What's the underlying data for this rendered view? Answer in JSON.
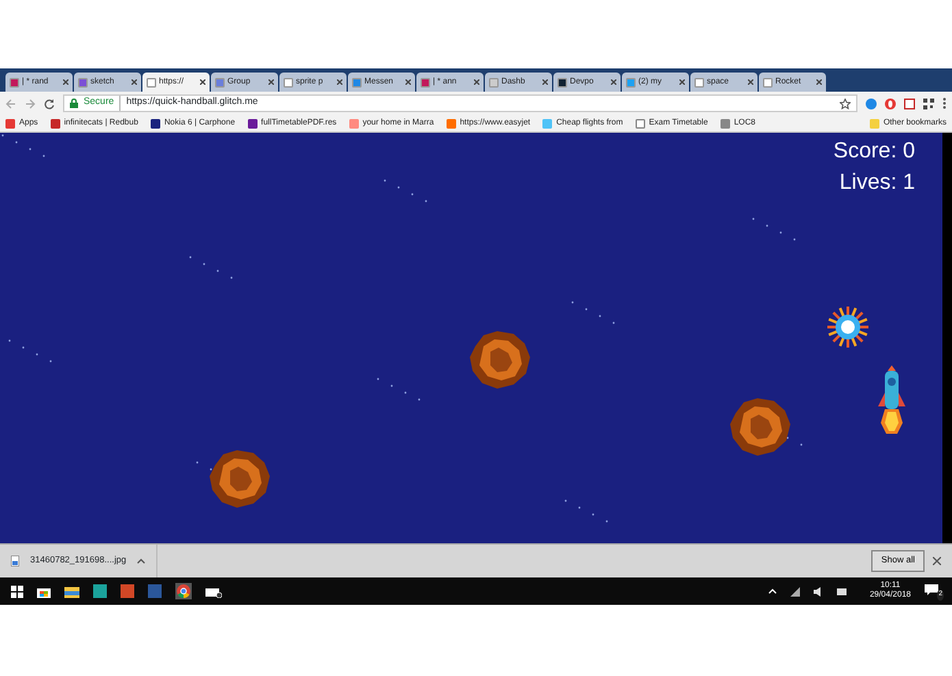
{
  "tabs": [
    {
      "label": "| * rand",
      "selected": false
    },
    {
      "label": "sketch",
      "selected": false
    },
    {
      "label": "https://",
      "selected": true
    },
    {
      "label": "Group",
      "selected": false
    },
    {
      "label": "sprite p",
      "selected": false
    },
    {
      "label": "Messen",
      "selected": false
    },
    {
      "label": "| * ann",
      "selected": false
    },
    {
      "label": "Dashb",
      "selected": false
    },
    {
      "label": "Devpo",
      "selected": false
    },
    {
      "label": "(2) my",
      "selected": false
    },
    {
      "label": "space",
      "selected": false
    },
    {
      "label": "Rocket",
      "selected": false
    }
  ],
  "address_bar": {
    "security": "Secure",
    "url": "https://quick-handball.glitch.me"
  },
  "bookmarks": [
    {
      "label": "Apps"
    },
    {
      "label": "infinitecats | Redbub"
    },
    {
      "label": "Nokia 6 | Carphone"
    },
    {
      "label": "fullTimetablePDF.res"
    },
    {
      "label": "your home in Marra"
    },
    {
      "label": "https://www.easyjet"
    },
    {
      "label": "Cheap flights from"
    },
    {
      "label": "Exam Timetable"
    },
    {
      "label": "LOC8"
    }
  ],
  "other_bookmarks": "Other bookmarks",
  "game": {
    "score": "Score: 0",
    "lives": "Lives: 1"
  },
  "download_bar": {
    "file": "31460782_191698....jpg",
    "show_all": "Show all"
  },
  "taskbar": {
    "time": "10:11",
    "date": "29/04/2018",
    "notifications": "2"
  }
}
